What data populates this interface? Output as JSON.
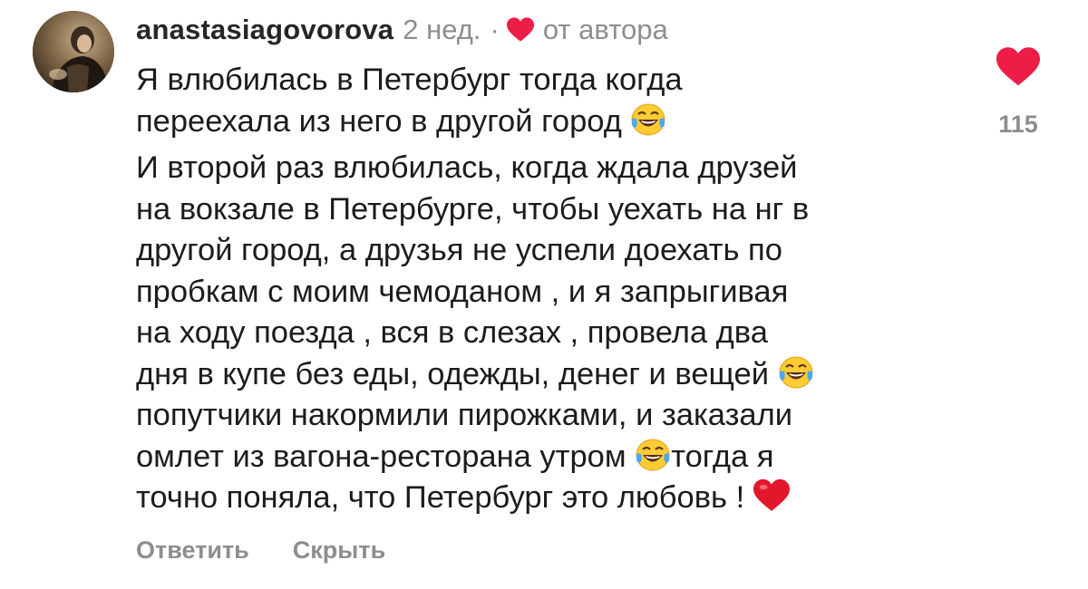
{
  "comment": {
    "username": "anastasiagovorova",
    "time": "2 нед.",
    "separator": "·",
    "author_badge_icon": "heart-icon",
    "author_badge_text": "от автора",
    "paragraphs": [
      {
        "lines": [
          "Я влюбилась в Петербург тогда когда",
          "переехала из него в другой город"
        ]
      },
      {
        "lines": [
          "И второй раз влюбилась, когда ждала друзей",
          "на вокзале в Петербурге, чтобы уехать на нг в",
          "другой город, а друзья не успели доехать по",
          "пробкам с моим чемоданом , и я запрыгивая",
          "на ходу поезда , вся в слезах , провела два",
          "дня в купе без еды, одежды, денег и вещей",
          "попутчики накормили пирожками, и заказали",
          "омлет из вагона-ресторана утром",
          "точно поняла, что Петербург это любовь !"
        ],
        "line_8_continuation": "тогда я"
      }
    ],
    "emoji_icons": [
      "laughing-crying-emoji",
      "laughing-crying-emoji",
      "laughing-crying-emoji",
      "red-heart-emoji"
    ],
    "actions": {
      "reply": "Ответить",
      "hide": "Скрыть"
    },
    "like": {
      "icon": "heart-icon",
      "count": "115",
      "color": "#ed1d48"
    }
  },
  "colors": {
    "text": "#262626",
    "secondary": "#8e8e8e",
    "heart": "#ed1d48"
  }
}
